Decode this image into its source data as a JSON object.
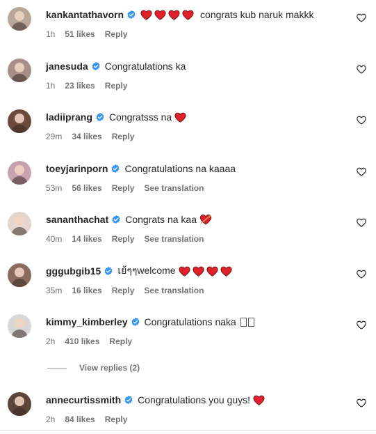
{
  "comments": [
    {
      "username": "kankantathavorn",
      "emoji_before": [
        "heart",
        "heart",
        "heart",
        "heart"
      ],
      "text": "congrats kub naruk makkk",
      "emoji_after": [],
      "time": "1h",
      "likes": "51 likes",
      "reply": "Reply",
      "translation": "",
      "avatar_color": "#b9a79a"
    },
    {
      "username": "janesuda",
      "emoji_before": [],
      "text": "Congratulations ka",
      "emoji_after": [],
      "time": "1h",
      "likes": "23 likes",
      "reply": "Reply",
      "translation": "",
      "avatar_color": "#a78e88"
    },
    {
      "username": "ladiiprang",
      "emoji_before": [],
      "text": "Congratsss na",
      "emoji_after": [
        "heart"
      ],
      "time": "29m",
      "likes": "34 likes",
      "reply": "Reply",
      "translation": "",
      "avatar_color": "#6b4a3c"
    },
    {
      "username": "toeyjarinporn",
      "emoji_before": [],
      "text": "Congratulations na kaaaa",
      "emoji_after": [],
      "time": "53m",
      "likes": "56 likes",
      "reply": "Reply",
      "translation": "See translation",
      "avatar_color": "#c6a1b0"
    },
    {
      "username": "sananthachat",
      "emoji_before": [],
      "text": "Congrats na kaa",
      "emoji_after": [
        "heart-arrow"
      ],
      "time": "40m",
      "likes": "14 likes",
      "reply": "Reply",
      "translation": "See translation",
      "avatar_color": "#e4d6cf"
    },
    {
      "username": "gggubgib15",
      "emoji_before": [],
      "text": "เย้ๆๆwelcome",
      "emoji_after": [
        "heart",
        "heart",
        "heart",
        "heart"
      ],
      "time": "35m",
      "likes": "16 likes",
      "reply": "Reply",
      "translation": "See translation",
      "avatar_color": "#8a6a5c"
    },
    {
      "username": "kimmy_kimberley",
      "emoji_before": [],
      "text": "Congratulations naka",
      "emoji_after": [
        "box",
        "box"
      ],
      "time": "2h",
      "likes": "410 likes",
      "reply": "Reply",
      "translation": "",
      "avatar_color": "#d7d7d7"
    },
    {
      "username": "annecurtissmith",
      "emoji_before": [],
      "text": "Congratulations you guys!",
      "emoji_after": [
        "heart"
      ],
      "time": "2h",
      "likes": "84 likes",
      "reply": "Reply",
      "translation": "",
      "avatar_color": "#5d4438"
    }
  ],
  "view_replies": "View replies (2)",
  "colors": {
    "verified": "#3897f0",
    "heart": "#e0202a",
    "meta_text": "#737373",
    "text": "#262626"
  },
  "icons": {
    "verified": "verified-badge-icon",
    "like": "heart-outline-icon",
    "emoji_heart": "red-heart-icon",
    "emoji_heart_arrow": "heart-with-arrow-icon"
  }
}
